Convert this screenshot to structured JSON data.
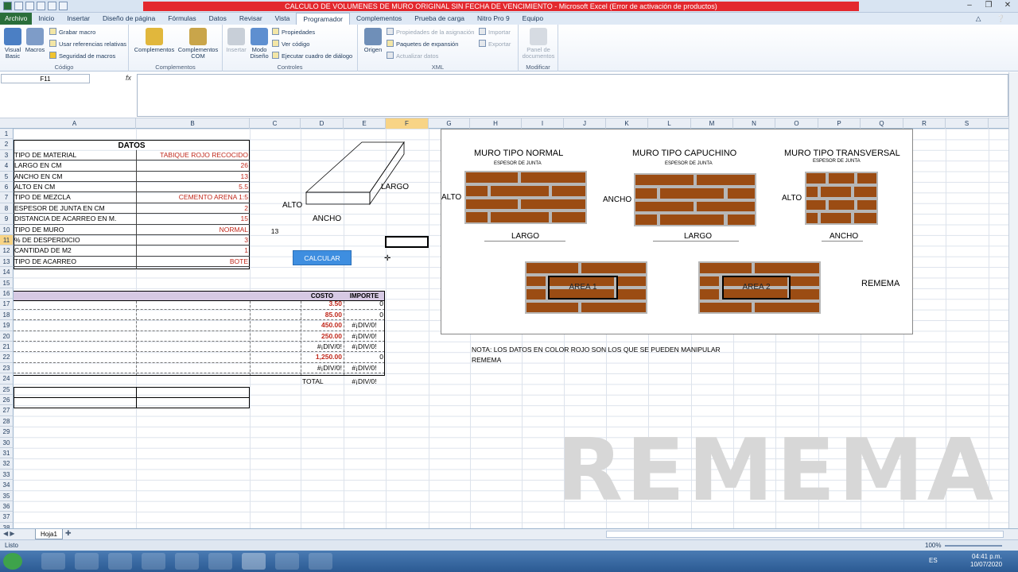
{
  "window": {
    "title": "CALCULO DE VOLUMENES DE MURO ORIGINAL SIN FECHA DE VENCIMIENTO - Microsoft Excel (Error de activación de productos)"
  },
  "tabs": [
    "Archivo",
    "Inicio",
    "Insertar",
    "Diseño de página",
    "Fórmulas",
    "Datos",
    "Revisar",
    "Vista",
    "Programador",
    "Complementos",
    "Prueba de carga",
    "Nitro Pro 9",
    "Equipo"
  ],
  "ribbon": {
    "codigo": {
      "label": "Código",
      "visual_basic": "Visual Basic",
      "macros": "Macros",
      "grabar": "Grabar macro",
      "relativas": "Usar referencias relativas",
      "seguridad": "Seguridad de macros"
    },
    "complementos": {
      "label": "Complementos",
      "complementos": "Complementos",
      "com": "Complementos COM"
    },
    "controles": {
      "label": "Controles",
      "insertar": "Insertar",
      "modo": "Modo Diseño",
      "propiedades": "Propiedades",
      "ver_codigo": "Ver código",
      "ejecutar": "Ejecutar cuadro de diálogo"
    },
    "xml": {
      "label": "XML",
      "origen": "Origen",
      "prop_asig": "Propiedades de la asignación",
      "paquetes": "Paquetes de expansión",
      "actualizar": "Actualizar datos",
      "importar": "Importar",
      "exportar": "Exportar"
    },
    "modificar": {
      "label": "Modificar",
      "panel": "Panel de documentos"
    }
  },
  "formula_bar": {
    "name_box": "F11",
    "fx": "fx",
    "content": ""
  },
  "columns": [
    "A",
    "B",
    "C",
    "D",
    "E",
    "F",
    "G",
    "H",
    "I",
    "J",
    "K",
    "L",
    "M",
    "N",
    "O",
    "P",
    "Q",
    "R",
    "S"
  ],
  "rows": [
    "1",
    "2",
    "3",
    "4",
    "5",
    "6",
    "7",
    "8",
    "9",
    "10",
    "11",
    "12",
    "13",
    "14",
    "15",
    "16",
    "17",
    "18",
    "19",
    "20",
    "21",
    "22",
    "23",
    "24",
    "25",
    "26",
    "27",
    "28",
    "29",
    "30",
    "31",
    "32",
    "33",
    "34",
    "35",
    "36",
    "37",
    "38"
  ],
  "datos": {
    "title": "DATOS",
    "items": [
      {
        "label": "TIPO DE MATERIAL",
        "value": "TABIQUE ROJO RECOCIDO"
      },
      {
        "label": "LARGO EN CM",
        "value": "26"
      },
      {
        "label": "ANCHO EN CM",
        "value": "13"
      },
      {
        "label": "ALTO EN CM",
        "value": "5.5"
      },
      {
        "label": "TIPO DE MEZCLA",
        "value": "CEMENTO ARENA 1:5"
      },
      {
        "label": "ESPESOR DE JUNTA EN CM",
        "value": "2"
      },
      {
        "label": "DISTANCIA DE ACARREO EN M.",
        "value": "15"
      },
      {
        "label": "TIPO DE MURO",
        "value": "NORMAL"
      },
      {
        "label": "% DE DESPERDICIO",
        "value": "3"
      },
      {
        "label": "CANTIDAD DE M2",
        "value": "1"
      },
      {
        "label": "TIPO DE ACARREO",
        "value": "BOTE"
      }
    ],
    "c10_value": "13"
  },
  "brick_diagram": {
    "alto": "ALTO",
    "ancho": "ANCHO",
    "largo": "LARGO"
  },
  "calc_button": "CALCULAR",
  "costs": {
    "header_costo": "COSTO",
    "header_importe": "IMPORTE",
    "rows": [
      {
        "costo": "3.50",
        "importe": "0",
        "red": true
      },
      {
        "costo": "85.00",
        "importe": "0",
        "red": true
      },
      {
        "costo": "450.00",
        "importe": "#¡DIV/0!",
        "red": true
      },
      {
        "costo": "250.00",
        "importe": "#¡DIV/0!",
        "red": true
      },
      {
        "costo": "#¡DIV/0!",
        "importe": "#¡DIV/0!",
        "red": false
      },
      {
        "costo": "1,250.00",
        "importe": "0",
        "red": true
      },
      {
        "costo": "#¡DIV/0!",
        "importe": "#¡DIV/0!",
        "red": false
      }
    ],
    "total_label": "TOTAL",
    "total_value": "#¡DIV/0!"
  },
  "wall_types": {
    "normal": {
      "title": "MURO TIPO NORMAL",
      "junta": "ESPESOR DE JUNTA",
      "side": "ALTO",
      "bottom": "LARGO"
    },
    "capuchino": {
      "title": "MURO TIPO CAPUCHINO",
      "junta": "ESPESOR DE JUNTA",
      "side": "ANCHO",
      "bottom": "LARGO"
    },
    "transversal": {
      "title": "MURO TIPO TRANSVERSAL",
      "junta": "ESPESOR DE JUNTA",
      "side": "ALTO",
      "bottom": "ANCHO"
    },
    "area1": "AREA 1",
    "area2": "AREA 2",
    "brand": "REMEMA"
  },
  "note": {
    "line1": "NOTA: LOS DATOS EN COLOR ROJO SON LOS QUE SE PUEDEN MANIPULAR",
    "line2": "REMEMA"
  },
  "watermark": "REMEMA",
  "sheet_tab": "Hoja1",
  "status": {
    "ready": "Listo",
    "zoom": "100%",
    "lang": "ES",
    "time": "04:41 p.m.",
    "date": "10/07/2020"
  },
  "colors": {
    "accent_red": "#c0281b",
    "brick": "#9b4c13",
    "mortar": "#b7b7b7",
    "selection": "#f8d486",
    "button": "#3e8ee0"
  }
}
